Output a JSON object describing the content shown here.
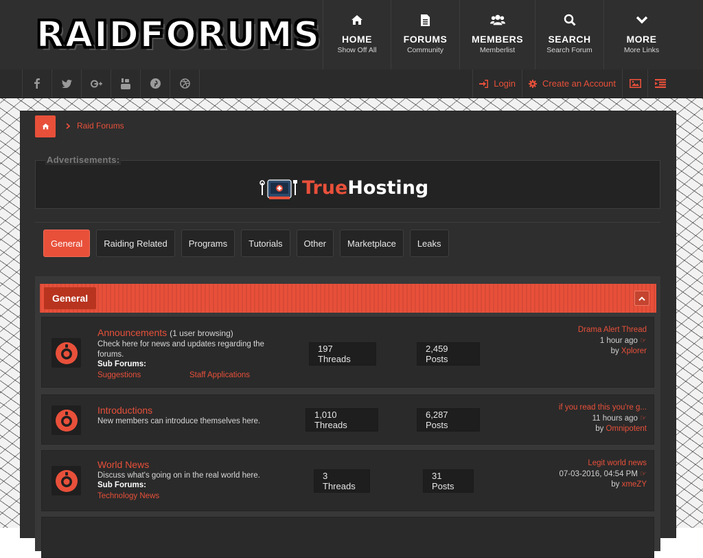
{
  "brand": {
    "logo_text": "RAIDFORUMS"
  },
  "nav": [
    {
      "title": "HOME",
      "sub": "Show Off All",
      "icon": "home-icon"
    },
    {
      "title": "FORUMS",
      "sub": "Community",
      "icon": "document-icon"
    },
    {
      "title": "MEMBERS",
      "sub": "Memberlist",
      "icon": "users-icon"
    },
    {
      "title": "SEARCH",
      "sub": "Search Forum",
      "icon": "search-icon"
    },
    {
      "title": "MORE",
      "sub": "More Links",
      "icon": "chevron-down-icon"
    }
  ],
  "social": [
    "f",
    "t",
    "g+",
    "yt",
    "p",
    "d"
  ],
  "auth": {
    "login": "Login",
    "register": "Create an Account"
  },
  "breadcrumb": {
    "label": "Raid Forums"
  },
  "ad": {
    "label": "Advertisements:",
    "brand_a": "True",
    "brand_b": "Hosting"
  },
  "tabs": [
    "General",
    "Raiding Related",
    "Programs",
    "Tutorials",
    "Other",
    "Marketplace",
    "Leaks"
  ],
  "category": {
    "title": "General"
  },
  "forums": [
    {
      "title": "Announcements",
      "browsing": "(1 user browsing)",
      "desc1": "Check here for news and updates regarding the",
      "desc2": "forums.",
      "sub_label": "Sub Forums:",
      "sub_links": [
        "Suggestions",
        "Staff Applications"
      ],
      "threads": "197 Threads",
      "posts": "2,459 Posts",
      "last_thread": "Drama Alert Thread",
      "last_time": "1 hour ago",
      "last_by": "by",
      "last_user": "Xplorer"
    },
    {
      "title": "Introductions",
      "desc1": "New members can introduce themselves here.",
      "threads": "1,010 Threads",
      "posts": "6,287 Posts",
      "last_thread": "if you read this you're g...",
      "last_time": "11 hours ago",
      "last_by": "by",
      "last_user": "Omnipotent"
    },
    {
      "title": "World News",
      "desc1": "Discuss what's going on in the real world here.",
      "sub_label": "Sub Forums:",
      "sub_links": [
        "Technology News"
      ],
      "threads": "3 Threads",
      "posts": "31 Posts",
      "last_thread": "Legit world news",
      "last_time": "07-03-2016, 04:54 PM",
      "last_by": "by",
      "last_user": "xmeZY"
    }
  ],
  "colors": {
    "accent": "#e8503a",
    "dark": "#2e2e2e",
    "header": "#2f2f2f"
  }
}
